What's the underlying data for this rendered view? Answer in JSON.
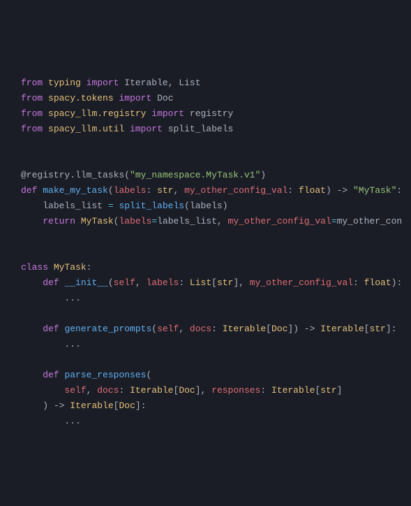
{
  "imports": {
    "l1": {
      "from": "from",
      "mod": "typing",
      "import": "import",
      "names": "Iterable, List"
    },
    "l2": {
      "from": "from",
      "mod": "spacy.tokens",
      "import": "import",
      "names": "Doc"
    },
    "l3": {
      "from": "from",
      "mod": "spacy_llm.registry",
      "import": "import",
      "names": "registry"
    },
    "l4": {
      "from": "from",
      "mod": "spacy_llm.util",
      "import": "import",
      "names": "split_labels"
    }
  },
  "decorator": {
    "at": "@registry.llm_tasks",
    "lp": "(",
    "arg": "\"my_namespace.MyTask.v1\"",
    "rp": ")"
  },
  "factory": {
    "def": "def",
    "name": "make_my_task",
    "lp": "(",
    "p1": "labels",
    "c1": ": ",
    "t1": "str",
    "cm1": ", ",
    "p2": "my_other_config_val",
    "c2": ": ",
    "t2": "float",
    "rp": ")",
    "arrow": " -> ",
    "ret": "\"MyTask\"",
    "colon": ":"
  },
  "body1": {
    "lhs": "labels_list",
    "eq": " = ",
    "fn": "split_labels",
    "lp": "(",
    "arg": "labels",
    "rp": ")"
  },
  "body2": {
    "ret": "return",
    "sp": " ",
    "cls": "MyTask",
    "lp": "(",
    "k1": "labels",
    "eq1": "=",
    "v1": "labels_list",
    "cm": ", ",
    "k2": "my_other_config_val",
    "eq2": "=",
    "v2": "my_other_con"
  },
  "classdef": {
    "kw": "class",
    "sp": " ",
    "name": "MyTask",
    "colon": ":"
  },
  "init": {
    "def": "def",
    "name": "__init__",
    "lp": "(",
    "p1": "self",
    "cm1": ", ",
    "p2": "labels",
    "c2": ": ",
    "t2a": "List",
    "lb": "[",
    "t2b": "str",
    "rb": "]",
    "cm2": ", ",
    "p3": "my_other_config_val",
    "c3": ": ",
    "t3": "float",
    "rp": ")",
    "colon": ":"
  },
  "dots": "...",
  "gen": {
    "def": "def",
    "name": "generate_prompts",
    "lp": "(",
    "p1": "self",
    "cm1": ", ",
    "p2": "docs",
    "c2": ": ",
    "t2a": "Iterable",
    "lb": "[",
    "t2b": "Doc",
    "rb": "]",
    "rp": ")",
    "arrow": " -> ",
    "rta": "Iterable",
    "rlb": "[",
    "rtb": "str",
    "rrb": "]",
    "colon": ":"
  },
  "parse": {
    "def": "def",
    "name": "parse_responses",
    "lp": "(",
    "p1": "self",
    "cm1": ", ",
    "p2": "docs",
    "c2": ": ",
    "t2a": "Iterable",
    "lb2": "[",
    "t2b": "Doc",
    "rb2": "]",
    "cm2": ", ",
    "p3": "responses",
    "c3": ": ",
    "t3a": "Iterable",
    "lb3": "[",
    "t3b": "str",
    "rb3": "]",
    "rp": ")",
    "arrow": " -> ",
    "rta": "Iterable",
    "rlb": "[",
    "rtb": "Doc",
    "rrb": "]",
    "colon": ":"
  }
}
